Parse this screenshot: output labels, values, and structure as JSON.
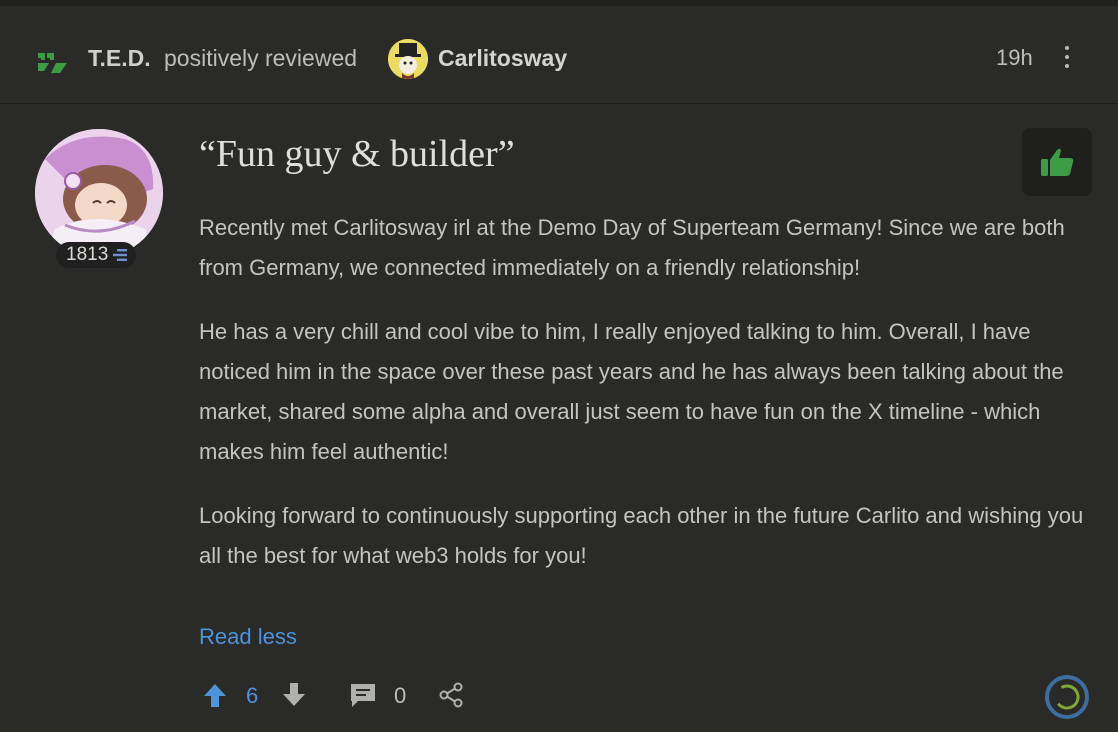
{
  "review": {
    "author": "T.E.D.",
    "verb": "positively reviewed",
    "target": "Carlitosway",
    "time": "19h",
    "score": "1813",
    "title": "“Fun guy & builder”",
    "paragraphs": [
      "Recently met Carlitosway irl at the Demo Day of Superteam Germany! Since we are both from Germany, we connected immediately on a friendly relationship!",
      "He has a very chill and cool vibe to him, I really enjoyed talking to him. Overall, I have noticed him in the space over these past years and he has always been talking about the market, shared some alpha and overall just seem to have fun on the X timeline - which makes him feel authentic!",
      "Looking forward to continuously supporting each other in the future Carlito and wishing you all the best for what web3 holds for you!"
    ],
    "read_less": "Read less",
    "upvotes": "6",
    "comments": "0"
  },
  "icons": {
    "logo": "ethos-logo-icon",
    "menu": "more-vertical-icon",
    "positive": "thumbs-up-icon",
    "upvote": "arrow-up-icon",
    "downvote": "arrow-down-icon",
    "comment": "comment-icon",
    "share": "share-icon",
    "score": "score-level-icon",
    "status": "progress-ring-icon"
  },
  "colors": {
    "accent_green": "#3d9a45",
    "link_blue": "#4f93d8",
    "background": "#2a2a28"
  }
}
